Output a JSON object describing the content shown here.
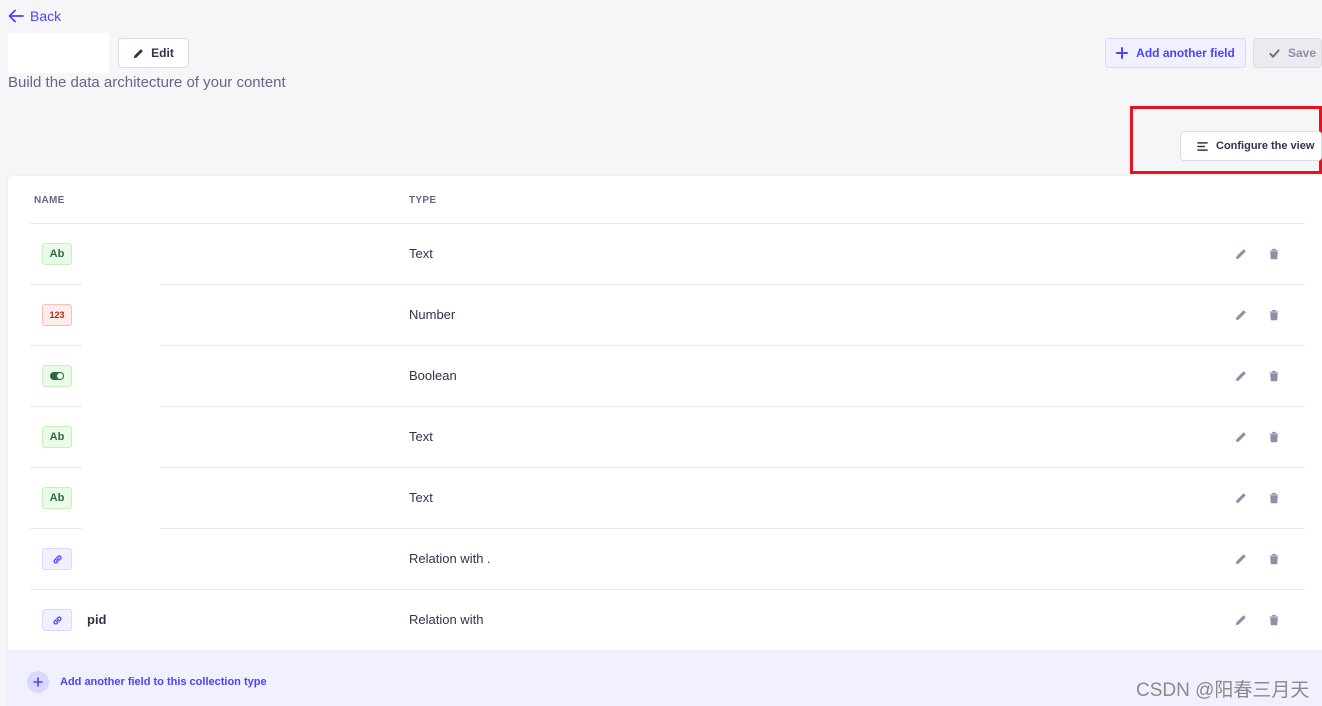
{
  "header": {
    "back_label": "Back",
    "edit_label": "Edit",
    "subtitle": "Build the data architecture of your content",
    "add_field_label": "Add another field",
    "save_label": "Save",
    "configure_label": "Configure the view"
  },
  "table": {
    "col_name": "NAME",
    "col_type": "TYPE",
    "rows": [
      {
        "badge": "Ab",
        "badge_kind": "text",
        "name": "",
        "type": "Text"
      },
      {
        "badge": "123",
        "badge_kind": "number",
        "name": "",
        "type": "Number"
      },
      {
        "badge": "",
        "badge_kind": "boolean",
        "name": "",
        "type": "Boolean"
      },
      {
        "badge": "Ab",
        "badge_kind": "text",
        "name": "",
        "type": "Text"
      },
      {
        "badge": "Ab",
        "badge_kind": "text",
        "name": "",
        "type": "Text"
      },
      {
        "badge": "",
        "badge_kind": "relation",
        "name": "",
        "type": "Relation with ."
      },
      {
        "badge": "",
        "badge_kind": "relation",
        "name": "pid",
        "type": "Relation with"
      }
    ]
  },
  "footer": {
    "add_label": "Add another field to this collection type"
  },
  "watermark": "CSDN @阳春三月天",
  "colors": {
    "primary": "#4945ff",
    "highlight": "#e8121b",
    "text_badge": "#2f6846",
    "number_badge": "#b72b1a"
  }
}
